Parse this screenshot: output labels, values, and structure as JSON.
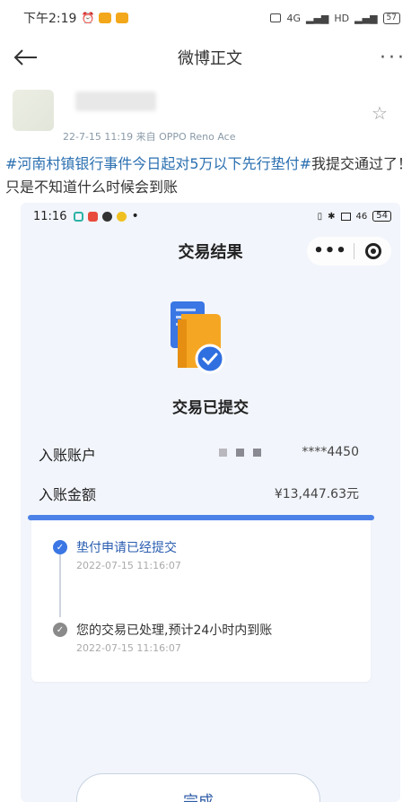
{
  "status_bar": {
    "time": "下午2:19",
    "signal_1": "4G",
    "signal_2": "HD",
    "battery": "57"
  },
  "nav": {
    "title": "微博正文",
    "more": "···"
  },
  "post": {
    "meta": "22-7-15 11:19  来自 OPPO Reno Ace",
    "topic": "#河南村镇银行事件今日起对5万以下先行垫付#",
    "text": "我提交通过了！只是不知道什么时候会到账"
  },
  "screenshot": {
    "status": {
      "time": "11:16",
      "signal": "46",
      "battery": "54"
    },
    "title": "交易结果",
    "capsule_more": "•••",
    "status_text": "交易已提交",
    "account": {
      "label": "入账账户",
      "value": "****4450"
    },
    "amount": {
      "label": "入账金额",
      "value": "¥13,447.63元"
    },
    "steps": [
      {
        "title": "垫付申请已经提交",
        "time": "2022-07-15 11:16:07",
        "state": "done",
        "color": "#3a76e4"
      },
      {
        "title": "您的交易已处理,预计24小时内到账",
        "time": "2022-07-15 11:16:07",
        "state": "pending",
        "color": "#8a8a8a"
      }
    ],
    "done_button": "完成"
  },
  "colors": {
    "accent": "#3a76e4",
    "topic": "#2a6fb0",
    "doc_orange": "#f5a623"
  }
}
